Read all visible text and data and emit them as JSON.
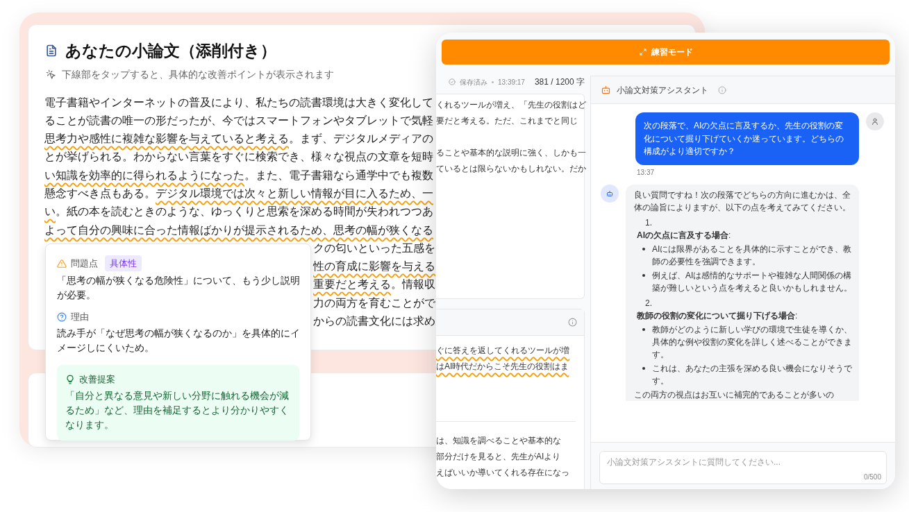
{
  "essay_window": {
    "title": "あなたの小論文（添削付き）",
    "hint": "下線部をタップすると、具体的な改善ポイントが表示されます",
    "lines": [
      {
        "kind": "full",
        "segments": [
          {
            "text": "電子書籍やインターネットの普及により、私たちの読書環境は大きく変化して",
            "underlined": false
          }
        ]
      },
      {
        "kind": "full",
        "segments": [
          {
            "text": "ることが読書の唯一の形だったが、今ではスマートフォンやタブレットで気軽",
            "underlined": false
          }
        ]
      },
      {
        "kind": "full",
        "segments": [
          {
            "text": "思考力や感性に複雑な影響を与えていると考える",
            "underlined": true
          },
          {
            "text": "。まず、デジタルメディアの",
            "underlined": false
          }
        ]
      },
      {
        "kind": "full",
        "segments": [
          {
            "text": "とが挙げられる。わからない言葉をすぐに検索でき、様々な視点の文章を短時",
            "underlined": false
          }
        ]
      },
      {
        "kind": "full",
        "segments": [
          {
            "text": "い知識を効率的に得られるようになった",
            "underlined": true
          },
          {
            "text": "。また、電子書籍なら通学中でも複数",
            "underlined": false
          }
        ]
      },
      {
        "kind": "full",
        "segments": [
          {
            "text": "懸念すべき点もある。",
            "underlined": false
          },
          {
            "text": "デジタル環境では次々と新しい情報が目に入るため、一",
            "underlined": true
          }
        ]
      },
      {
        "kind": "full",
        "segments": [
          {
            "text": "い",
            "underlined": true
          },
          {
            "text": "。紙の本を読むときのような、ゆっくりと思索を深める時間が失われつつあ",
            "underlined": false
          }
        ]
      },
      {
        "kind": "full",
        "segments": [
          {
            "text": "よって自分の興味に合った情報ばかりが提示されるため、思考の幅が狭くなる",
            "underlined": true
          }
        ]
      },
      {
        "kind": "partly_covered",
        "segments": [
          {
            "text": "クの匂いといった五感を",
            "underlined": false
          }
        ]
      },
      {
        "kind": "partly_covered",
        "segments": [
          {
            "text": "性の育成に影響を与える",
            "underlined": true
          }
        ]
      },
      {
        "kind": "partly_covered",
        "segments": [
          {
            "text": "重要だと考える",
            "underlined": true
          },
          {
            "text": "。情報収",
            "underlined": false
          }
        ]
      },
      {
        "kind": "partly_covered",
        "segments": [
          {
            "text": "力の両方を育むことがで",
            "underlined": false
          }
        ]
      },
      {
        "kind": "partly_covered",
        "segments": [
          {
            "text": "からの読書文化には求め",
            "underlined": false
          }
        ]
      }
    ]
  },
  "feedback_popup": {
    "problem_label": "問題点",
    "problem_tag": "具体性",
    "problem_text": "「思考の幅が狭くなる危険性」について、もう少し説明が必要。",
    "reason_label": "理由",
    "reason_text": "読み手が「なぜ思考の幅が狭くなるのか」を具体的にイメージしにくいため。",
    "suggestion_label": "改善提案",
    "suggestion_text": "「自分と異なる意見や新しい分野に触れる機会が減るため」など、理由を補足するとより分かりやすくなります。"
  },
  "practice_window": {
    "mode_button": "練習モード",
    "editor": {
      "save_status": "保存済み",
      "save_time": "13:39:17",
      "char_count": "381 / 1200 字",
      "card_1_paragraphs": [
        [
          {
            "segments": [
              {
                "text": "くれるツールが増え、「先生の役割はど",
                "underlined": false
              }
            ]
          },
          {
            "segments": [
              {
                "text": "要だと考える。ただ、これまでと同じ",
                "underlined": false
              }
            ]
          }
        ],
        [
          {
            "segments": [
              {
                "text": "ることや基本的な説明に強く、しかも一",
                "underlined": false
              }
            ]
          },
          {
            "segments": [
              {
                "text": "ているとは限らないかもしれない。だか",
                "underlined": false
              }
            ]
          }
        ]
      ],
      "card_2_top_lines": [
        {
          "segments": [
            {
              "text": "ぐに答えを返してくれるツールが増",
              "underlined": true
            }
          ]
        },
        {
          "segments": [
            {
              "text": "はAI時代だからこそ先生の役割はま",
              "underlined": true
            }
          ]
        }
      ],
      "card_2_bottom_lines": [
        {
          "segments": [
            {
              "text": "は、知識を調べることや基本的な",
              "underlined": false
            }
          ]
        },
        {
          "segments": [
            {
              "text": "部分だけを見ると、先生がAIより",
              "underlined": false
            }
          ]
        },
        {
          "segments": [
            {
              "text": "えばいいか導いてくれる存在になっ",
              "underlined": false
            }
          ]
        }
      ]
    },
    "assistant": {
      "title": "小論文対策アシスタント",
      "messages": [
        {
          "kind": "user",
          "text": "次の段落で、AIの欠点に言及するか、先生の役割の変化について掘り下げていくか迷っています。どちらの構成がより適切ですか？",
          "time": "13:37"
        },
        {
          "kind": "assistant",
          "intro": "良い質問ですね！次の段落でどちらの方向に進むかは、全体の論旨によりますが、以下の点を考えてみてください。",
          "sections": [
            {
              "number": "1.",
              "heading": "**AIの欠点に言及する場合**:",
              "bullets": [
                "AIには限界があることを具体的に示すことができ、教師の必要性を強調できます。",
                "例えば、AIは感情的なサポートや複雑な人間関係の構築が難しいという点を考えると良いかもしれません。"
              ]
            },
            {
              "number": "2.",
              "heading": "**教師の役割の変化について掘り下げる場合**:",
              "bullets": [
                "教師がどのように新しい学びの環境で生徒を導くか、具体的な例や役割の変化を詳しく述べることができます。",
                "これは、あなたの主張を深める良い機会になりそうです。"
              ]
            }
          ],
          "outro": "この両方の視点はお互いに補完的であることが多いの"
        }
      ],
      "input": {
        "placeholder": "小論文対策アシスタントに質問してください...",
        "counter": "0/500"
      }
    }
  }
}
